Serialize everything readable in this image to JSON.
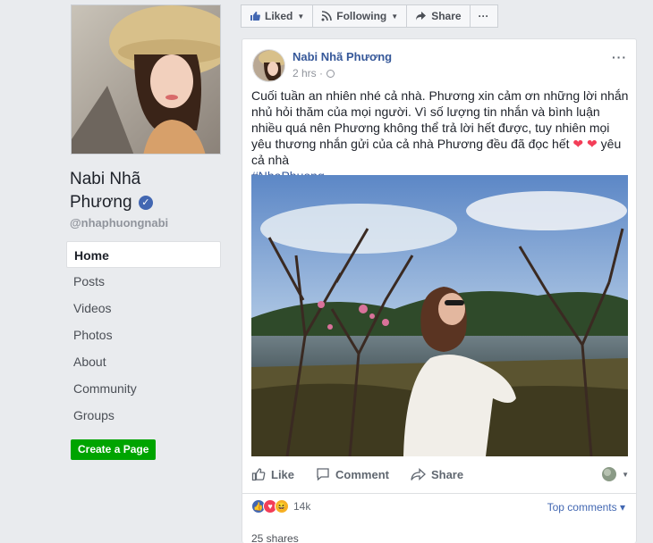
{
  "sidebar": {
    "name_line1": "Nabi Nhã",
    "name_line2": "Phương",
    "verified_icon": "✓",
    "handle": "@nhaphuongnabi",
    "nav": [
      "Home",
      "Posts",
      "Videos",
      "Photos",
      "About",
      "Community",
      "Groups"
    ],
    "create_page": "Create a Page"
  },
  "action_bar": {
    "liked": "Liked",
    "following": "Following",
    "share": "Share",
    "more": "···"
  },
  "post": {
    "author": "Nabi Nhã Phương",
    "time": "2 hrs ·",
    "more": "···",
    "text_main": "Cuối tuần an nhiên nhé cả nhà. Phương xin cảm ơn những lời nhắn nhủ hỏi thăm của mọi người. Vì số lượng tin nhắn và bình luận nhiều quá nên Phương không thể trả lời hết được, tuy nhiên mọi yêu thương nhắn gửi của cả nhà Phương đều đã đọc hết",
    "hearts": "❤ ❤",
    "text_end": "yêu cả nhà",
    "hashtag": "#NhaPhuong",
    "like": "Like",
    "comment": "Comment",
    "share": "Share",
    "reaction_count": "14k",
    "top_comments": "Top comments ▾",
    "shares": "25 shares"
  },
  "colors": {
    "link": "#365899",
    "brand": "#4267b2",
    "green": "#00a400",
    "love": "#f33e58"
  }
}
